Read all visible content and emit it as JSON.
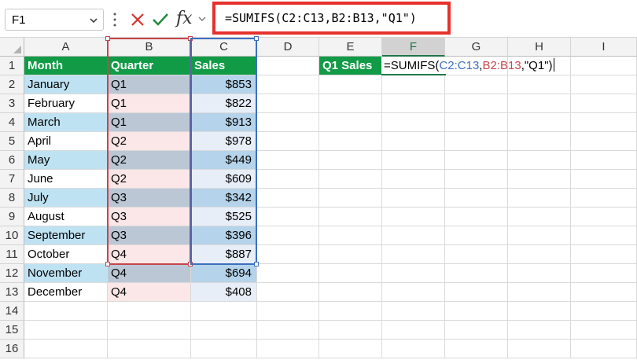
{
  "name_box": {
    "value": "F1"
  },
  "formula_bar": {
    "formula": "=SUMIFS(C2:C13,B2:B13,\"Q1\")",
    "fx_label": "fx",
    "highlight_color": "#e5322d"
  },
  "columns": [
    "A",
    "B",
    "C",
    "D",
    "E",
    "F",
    "G",
    "H",
    "I"
  ],
  "rows": [
    "1",
    "2",
    "3",
    "4",
    "5",
    "6",
    "7",
    "8",
    "9",
    "10",
    "11",
    "12",
    "13",
    "14",
    "15",
    "16"
  ],
  "table": {
    "headers": [
      "Month",
      "Quarter",
      "Sales"
    ],
    "data": [
      [
        "January",
        "Q1",
        "$853"
      ],
      [
        "February",
        "Q1",
        "$822"
      ],
      [
        "March",
        "Q1",
        "$913"
      ],
      [
        "April",
        "Q2",
        "$978"
      ],
      [
        "May",
        "Q2",
        "$449"
      ],
      [
        "June",
        "Q2",
        "$609"
      ],
      [
        "July",
        "Q3",
        "$342"
      ],
      [
        "August",
        "Q3",
        "$525"
      ],
      [
        "September",
        "Q3",
        "$396"
      ],
      [
        "October",
        "Q4",
        "$887"
      ],
      [
        "November",
        "Q4",
        "$694"
      ],
      [
        "December",
        "Q4",
        "$408"
      ]
    ],
    "header_color": "#119b46"
  },
  "summary": {
    "label": "Q1 Sales",
    "edit_prefix": "=SUMIFS(",
    "edit_arg1": "C2:C13",
    "edit_comma1": ",",
    "edit_arg2": "B2:B13",
    "edit_suffix": ",\"Q1\")",
    "arg1_color": "#3d6fbf",
    "arg2_color": "#c9444a"
  },
  "active_column": "F"
}
